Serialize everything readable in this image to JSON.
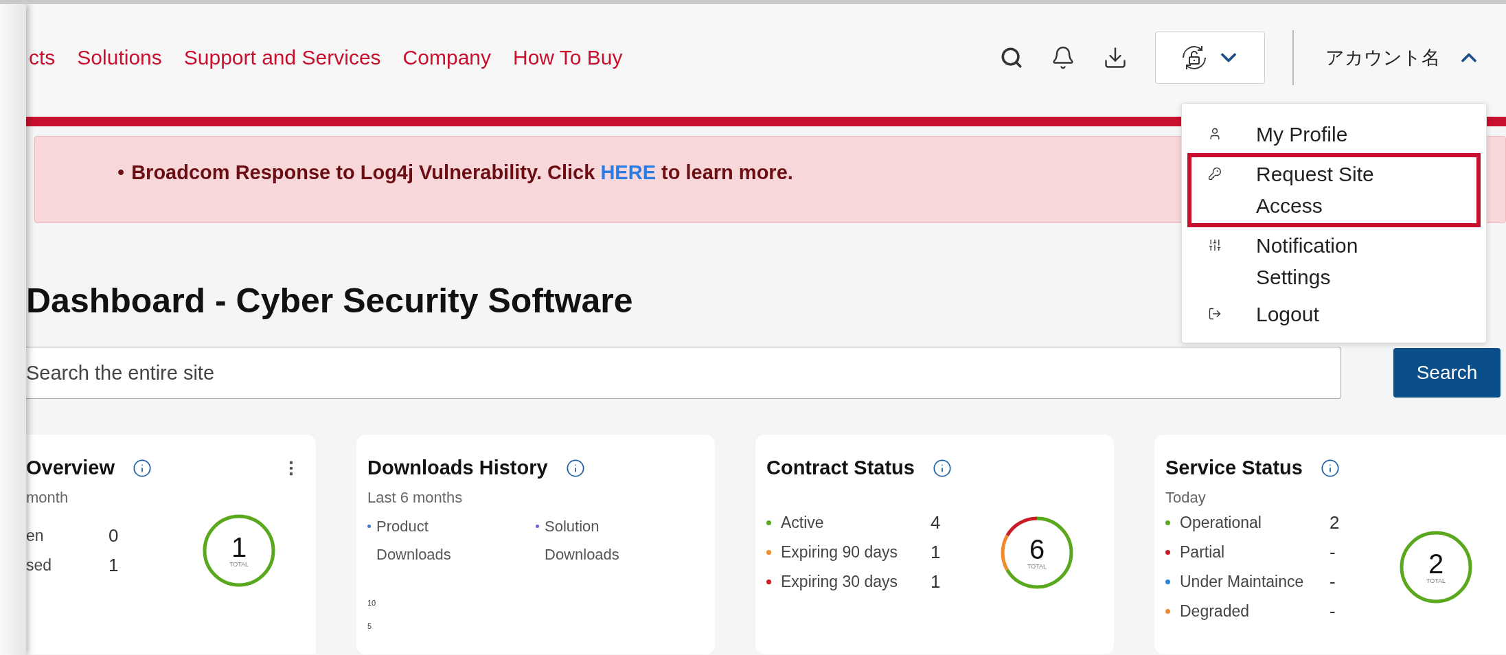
{
  "nav": {
    "items": [
      "cts",
      "Solutions",
      "Support and Services",
      "Company",
      "How To Buy"
    ]
  },
  "header": {
    "account_name": "アカウント名",
    "account_menu_expanded": true
  },
  "account_menu": [
    {
      "kind": "profile",
      "label": "My Profile",
      "highlighted": false
    },
    {
      "kind": "key",
      "label": "Request Site Access",
      "highlighted": true
    },
    {
      "kind": "settings",
      "label": "Notification Settings",
      "highlighted": false
    },
    {
      "kind": "logout",
      "label": "Logout",
      "highlighted": false
    }
  ],
  "alert": {
    "bullet": "•",
    "before": "Broadcom Response to Log4j Vulnerability. Click",
    "link": "HERE",
    "after": "to learn more."
  },
  "title": "Dashboard - Cyber Security Software",
  "search": {
    "placeholder": "Search the entire site",
    "button": "Search"
  },
  "cards": [
    {
      "kind": "status",
      "title": "Overview",
      "menu": true,
      "subtitle": "month",
      "rows": [
        {
          "label": "en",
          "value": "0"
        },
        {
          "label": "sed",
          "value": "1"
        }
      ],
      "total": "1",
      "total_label": "TOTAL"
    },
    {
      "kind": "history",
      "title": "Downloads History",
      "subtitle": "Last 6 months",
      "legend": [
        {
          "label": "Product Downloads",
          "color": "#3b7dd8"
        },
        {
          "label": "Solution Downloads",
          "color": "#7b5cd6"
        }
      ],
      "y_ticks": [
        "10",
        "5"
      ]
    },
    {
      "kind": "status",
      "title": "Contract Status",
      "rows": [
        {
          "label": "Active",
          "value": "4",
          "color": "#5aa81e"
        },
        {
          "label": "Expiring 90 days",
          "value": "1",
          "color": "#ef8a2f"
        },
        {
          "label": "Expiring 30 days",
          "value": "1",
          "color": "#c81d25"
        }
      ],
      "total": "6",
      "total_label": "TOTAL"
    },
    {
      "kind": "status",
      "title": "Service Status",
      "subtitle": "Today",
      "rows": [
        {
          "label": "Operational",
          "value": "2",
          "color": "#5aa81e"
        },
        {
          "label": "Partial",
          "value": "-",
          "color": "#c81d25"
        },
        {
          "label": "Under Maintaince",
          "value": "-",
          "color": "#2a86e0"
        },
        {
          "label": "Degraded",
          "value": "-",
          "color": "#ef8a2f"
        }
      ],
      "total": "2",
      "total_label": "TOTAL"
    }
  ]
}
